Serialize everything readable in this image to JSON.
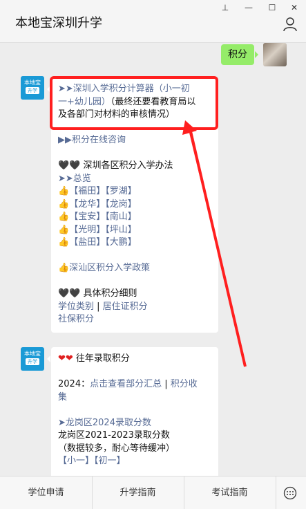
{
  "window": {
    "title": "本地宝深圳升学",
    "pin_icon": "⊥",
    "minimize_icon": "—",
    "maximize_icon": "☐",
    "close_icon": "✕"
  },
  "chat": {
    "my_message": "积分",
    "bot_avatar": {
      "top": "本地宝",
      "bottom": "升学"
    },
    "message1": {
      "line1": "➤➤深圳入学积分计算器（小一初",
      "line2": "一+幼儿园）",
      "line2_note": "（最终还要看教育局以",
      "line3": "及各部门对材料的审核情况）",
      "consult": "▶▶积分在线咨询",
      "section_title": "🖤🖤 深圳各区积分入学办法",
      "overview": "➤➤总览",
      "district_prefix": "👍",
      "districts": [
        [
          "【福田】",
          "【罗湖】"
        ],
        [
          "【龙华】",
          "【龙岗】"
        ],
        [
          "【宝安】",
          "【南山】"
        ],
        [
          "【光明】",
          "【坪山】"
        ],
        [
          "【盐田】",
          "【大鹏】"
        ]
      ],
      "shenshan": "👍深汕区积分入学政策",
      "detail_title": "🖤🖤 具体积分细则",
      "detail_link1": "学位类别",
      "detail_sep": " | ",
      "detail_link2": "居住证积分",
      "detail_link3": "社保积分"
    },
    "message2": {
      "title_hearts": "❤❤",
      "title": " 往年录取积分",
      "year_prefix": "2024：",
      "year_link1": "点击查看部分汇总",
      "year_sep": " | ",
      "year_link2a": "积分收",
      "year_link2b": "集",
      "longgang_link": "➤龙岗区2024录取分数",
      "longgang_range": "龙岗区2021-2023录取分数",
      "longgang_note": "（数据较多，耐心等待缓冲）",
      "grade_links": [
        "【小一】",
        "【初一】"
      ]
    }
  },
  "bottom_tabs": [
    "学位申请",
    "升学指南",
    "考试指南"
  ],
  "colors": {
    "link": "#576b95",
    "highlight": "#ff1f1f",
    "my_bubble": "#95ec69",
    "arrow": "#ff1f1f"
  }
}
